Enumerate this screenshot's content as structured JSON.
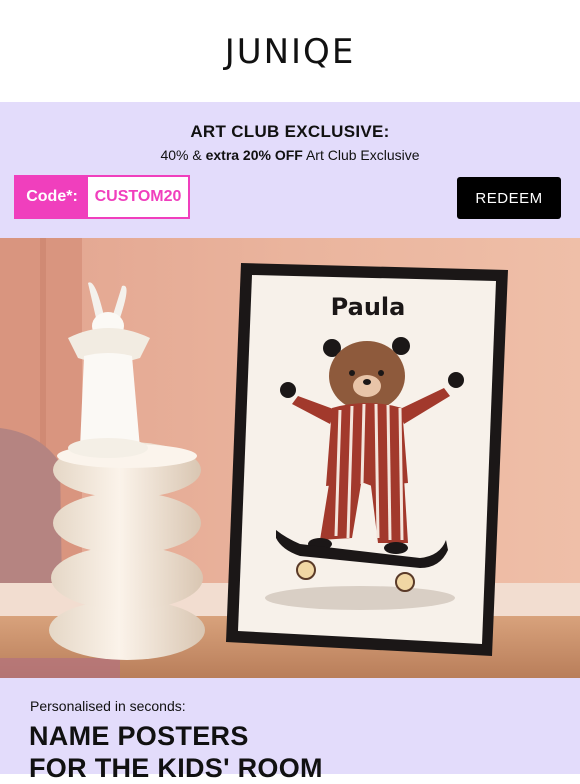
{
  "brand": {
    "logo_text": "JUNIQE"
  },
  "promo": {
    "title": "ART CLUB EXCLUSIVE:",
    "subtitle_prefix": "40% & ",
    "subtitle_bold": "extra 20% OFF",
    "subtitle_suffix": " Art Club Exclusive",
    "code_label": "Code*:",
    "code_value": "CUSTOM20",
    "redeem_label": "REDEEM",
    "accent_color": "#f03fbd",
    "background_color": "#e3dcfb"
  },
  "hero": {
    "poster_name": "Paula"
  },
  "feature": {
    "kicker": "Personalised in seconds:",
    "headline_line1": "NAME POSTERS",
    "headline_line2": "FOR THE KIDS' ROOM"
  }
}
